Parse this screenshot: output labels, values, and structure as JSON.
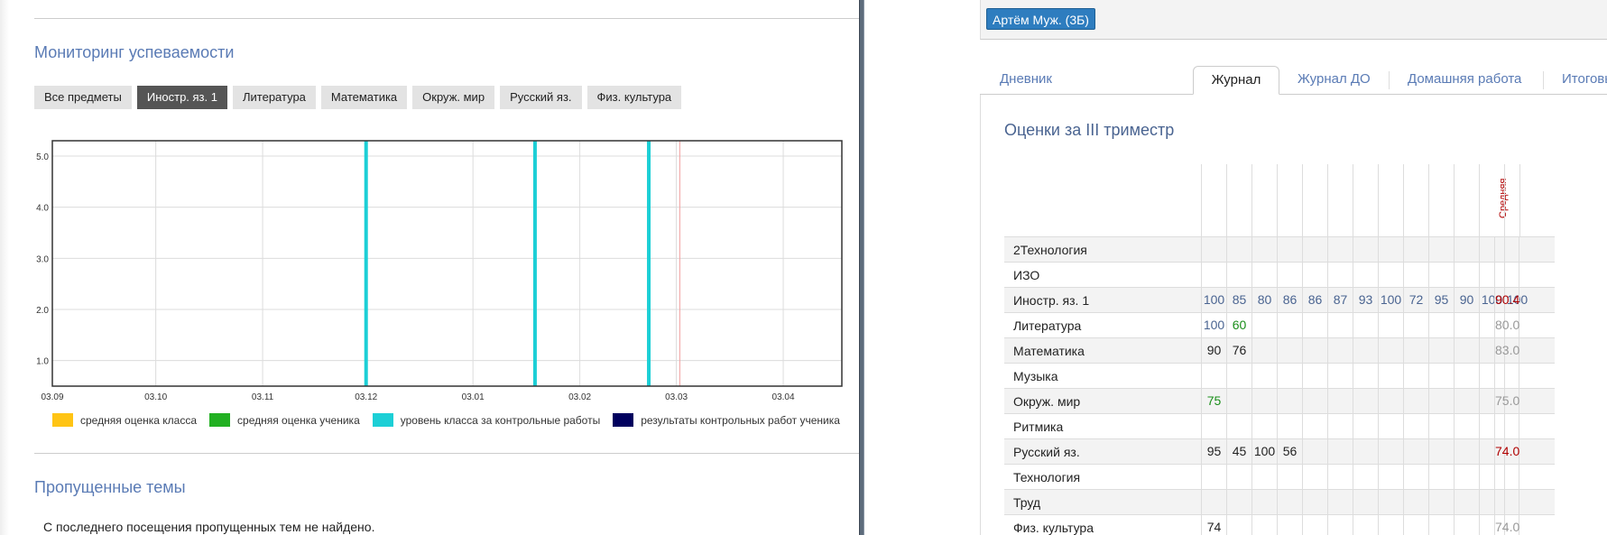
{
  "left": {
    "monitoring_title": "Мониторинг успеваемости",
    "subject_tabs": [
      {
        "label": "Все предметы",
        "active": false
      },
      {
        "label": "Иностр. яз. 1",
        "active": true
      },
      {
        "label": "Литература",
        "active": false
      },
      {
        "label": "Математика",
        "active": false
      },
      {
        "label": "Окруж. мир",
        "active": false
      },
      {
        "label": "Русский яз.",
        "active": false
      },
      {
        "label": "Физ. культура",
        "active": false
      }
    ],
    "legend": [
      {
        "label": "средняя оценка класса",
        "color": "#ffc414"
      },
      {
        "label": "средняя оценка ученика",
        "color": "#22b022"
      },
      {
        "label": "уровень класса за контрольные работы",
        "color": "#1ccfd6"
      },
      {
        "label": "результаты контрольных работ ученика",
        "color": "#00005e"
      }
    ],
    "missed_title": "Пропущенные темы",
    "missed_text": "С последнего посещения пропущенных тем не найдено."
  },
  "chart_data": {
    "type": "bar",
    "x_ticks": [
      "03.09",
      "03.10",
      "03.11",
      "03.12",
      "03.01",
      "03.02",
      "03.03",
      "03.04"
    ],
    "y_ticks": [
      "1.0",
      "2.0",
      "3.0",
      "4.0",
      "5.0"
    ],
    "ylim": [
      0.5,
      5.3
    ],
    "grid": true,
    "series": [
      {
        "name": "уровень класса за контрольные работы",
        "color": "#1ccfd6",
        "x": [
          "2014-12-03",
          "2015-01-21",
          "2015-02-23"
        ],
        "values": [
          5.3,
          5.3,
          5.3
        ]
      }
    ],
    "marker": {
      "x": "2015-03-04",
      "color": "#f2a0a0"
    }
  },
  "right": {
    "student_button": "Артём Муж. (3Б)",
    "tabs": [
      {
        "label": "Дневник",
        "active": false
      },
      {
        "label": "Журнал",
        "active": true
      },
      {
        "label": "Журнал ДО",
        "active": false
      },
      {
        "label": "Домашняя работа",
        "active": false
      },
      {
        "label": "Итоговые оценки",
        "active": false
      }
    ],
    "grades_title": "Оценки за III триместр",
    "avg_header": "Средняя",
    "rows": [
      {
        "subject": "2Технология",
        "grades": [],
        "avg": ""
      },
      {
        "subject": "ИЗО",
        "grades": [],
        "avg": ""
      },
      {
        "subject": "Иностр. яз. 1",
        "grades": [
          {
            "v": "100",
            "c": "blue"
          },
          {
            "v": "85",
            "c": "blue"
          },
          {
            "v": "80",
            "c": "blue"
          },
          {
            "v": "86",
            "c": "blue"
          },
          {
            "v": "86",
            "c": "blue"
          },
          {
            "v": "87",
            "c": "blue"
          },
          {
            "v": "93",
            "c": "blue"
          },
          {
            "v": "100",
            "c": "blue"
          },
          {
            "v": "72",
            "c": "blue"
          },
          {
            "v": "95",
            "c": "blue"
          },
          {
            "v": "90",
            "c": "blue"
          },
          {
            "v": "100",
            "c": "blue"
          },
          {
            "v": "100",
            "c": "blue"
          }
        ],
        "avg": "90.4",
        "avg_color": "red"
      },
      {
        "subject": "Литература",
        "grades": [
          {
            "v": "100",
            "c": "blue"
          },
          {
            "v": "60",
            "c": "green"
          }
        ],
        "avg": "80.0",
        "avg_color": "gray"
      },
      {
        "subject": "Математика",
        "grades": [
          {
            "v": "90",
            "c": "black"
          },
          {
            "v": "76",
            "c": "black"
          }
        ],
        "avg": "83.0",
        "avg_color": "gray"
      },
      {
        "subject": "Музыка",
        "grades": [],
        "avg": ""
      },
      {
        "subject": "Окруж. мир",
        "grades": [
          {
            "v": "75",
            "c": "green"
          }
        ],
        "avg": "75.0",
        "avg_color": "gray"
      },
      {
        "subject": "Ритмика",
        "grades": [],
        "avg": ""
      },
      {
        "subject": "Русский яз.",
        "grades": [
          {
            "v": "95",
            "c": "black"
          },
          {
            "v": "45",
            "c": "black"
          },
          {
            "v": "100",
            "c": "black"
          },
          {
            "v": "56",
            "c": "black"
          }
        ],
        "avg": "74.0",
        "avg_color": "red"
      },
      {
        "subject": "Технология",
        "grades": [],
        "avg": ""
      },
      {
        "subject": "Труд",
        "grades": [],
        "avg": ""
      },
      {
        "subject": "Физ. культура",
        "grades": [
          {
            "v": "74",
            "c": "black"
          }
        ],
        "avg": "74.0",
        "avg_color": "gray"
      }
    ]
  }
}
